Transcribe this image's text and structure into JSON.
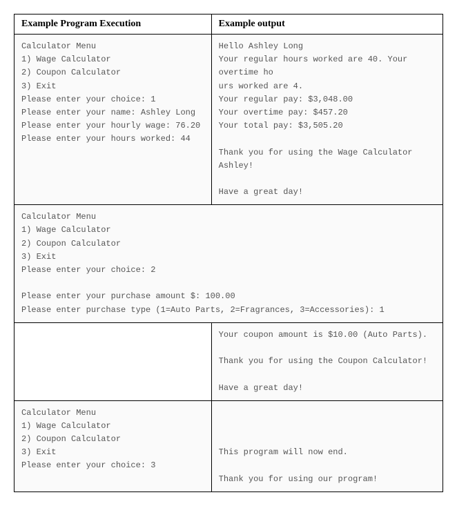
{
  "headers": {
    "left": "Example Program Execution",
    "right": "Example output"
  },
  "row1": {
    "left": "Calculator Menu\n1) Wage Calculator\n2) Coupon Calculator\n3) Exit\nPlease enter your choice: 1\nPlease enter your name: Ashley Long\nPlease enter your hourly wage: 76.20\nPlease enter your hours worked: 44",
    "right": "Hello Ashley Long\nYour regular hours worked are 40. Your overtime ho\nurs worked are 4.\nYour regular pay: $3,048.00\nYour overtime pay: $457.20\nYour total pay: $3,505.20\n\nThank you for using the Wage Calculator Ashley!\n\nHave a great day!"
  },
  "row2": {
    "full": "Calculator Menu\n1) Wage Calculator\n2) Coupon Calculator\n3) Exit\nPlease enter your choice: 2\n\nPlease enter your purchase amount $: 100.00\nPlease enter purchase type (1=Auto Parts, 2=Fragrances, 3=Accessories): 1"
  },
  "row3": {
    "left": "",
    "right": "Your coupon amount is $10.00 (Auto Parts).\n\nThank you for using the Coupon Calculator!\n\nHave a great day!"
  },
  "row4": {
    "left": "Calculator Menu\n1) Wage Calculator\n2) Coupon Calculator\n3) Exit\nPlease enter your choice: 3",
    "right": "\n\n\nThis program will now end.\n\nThank you for using our program!"
  }
}
